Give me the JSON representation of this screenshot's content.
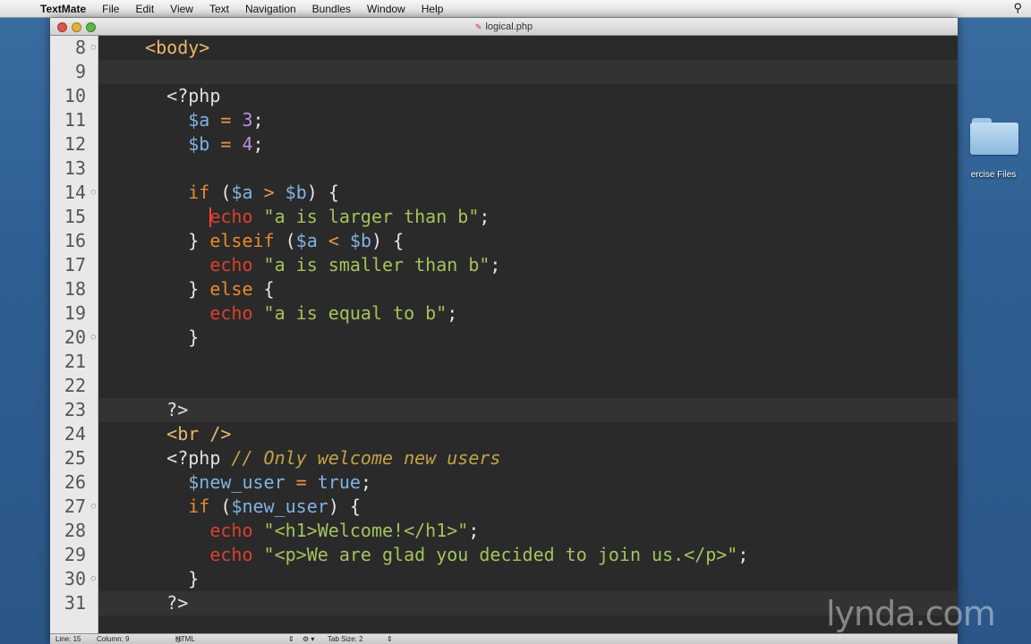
{
  "menubar": {
    "apple_glyph": "",
    "items": [
      "TextMate",
      "File",
      "Edit",
      "View",
      "Text",
      "Navigation",
      "Bundles",
      "Window",
      "Help"
    ],
    "spotlight_glyph": "⚲"
  },
  "desktop": {
    "folder_label": "ercise Files"
  },
  "window": {
    "title": "logical.php",
    "doc_icon": "✎"
  },
  "editor": {
    "lines": [
      {
        "n": "8",
        "fold": "○",
        "hl": false,
        "tokens": [
          [
            "t-plain",
            "  "
          ],
          [
            "t-tag",
            "<body>"
          ]
        ]
      },
      {
        "n": "9",
        "fold": "",
        "hl": true,
        "tokens": []
      },
      {
        "n": "10",
        "fold": "",
        "hl": false,
        "tokens": [
          [
            "t-plain",
            "    "
          ],
          [
            "t-php",
            "<?php"
          ]
        ]
      },
      {
        "n": "11",
        "fold": "",
        "hl": false,
        "tokens": [
          [
            "t-plain",
            "      "
          ],
          [
            "t-var",
            "$a"
          ],
          [
            "t-plain",
            " "
          ],
          [
            "t-op",
            "="
          ],
          [
            "t-plain",
            " "
          ],
          [
            "t-num",
            "3"
          ],
          [
            "t-plain",
            ";"
          ]
        ]
      },
      {
        "n": "12",
        "fold": "",
        "hl": false,
        "tokens": [
          [
            "t-plain",
            "      "
          ],
          [
            "t-var",
            "$b"
          ],
          [
            "t-plain",
            " "
          ],
          [
            "t-op",
            "="
          ],
          [
            "t-plain",
            " "
          ],
          [
            "t-num",
            "4"
          ],
          [
            "t-plain",
            ";"
          ]
        ]
      },
      {
        "n": "13",
        "fold": "",
        "hl": false,
        "tokens": []
      },
      {
        "n": "14",
        "fold": "○",
        "hl": false,
        "tokens": [
          [
            "t-plain",
            "      "
          ],
          [
            "t-kw",
            "if"
          ],
          [
            "t-plain",
            " ("
          ],
          [
            "t-var",
            "$a"
          ],
          [
            "t-plain",
            " "
          ],
          [
            "t-op",
            ">"
          ],
          [
            "t-plain",
            " "
          ],
          [
            "t-var",
            "$b"
          ],
          [
            "t-plain",
            ") {"
          ]
        ]
      },
      {
        "n": "15",
        "fold": "",
        "hl": false,
        "tokens": [
          [
            "t-plain",
            "        "
          ],
          [
            "t-echo",
            "echo"
          ],
          [
            "t-plain",
            " "
          ],
          [
            "t-str",
            "\"a is larger than b\""
          ],
          [
            "t-plain",
            ";"
          ]
        ]
      },
      {
        "n": "16",
        "fold": "",
        "hl": false,
        "tokens": [
          [
            "t-plain",
            "      } "
          ],
          [
            "t-kw",
            "elseif"
          ],
          [
            "t-plain",
            " ("
          ],
          [
            "t-var",
            "$a"
          ],
          [
            "t-plain",
            " "
          ],
          [
            "t-op",
            "<"
          ],
          [
            "t-plain",
            " "
          ],
          [
            "t-var",
            "$b"
          ],
          [
            "t-plain",
            ") {"
          ]
        ]
      },
      {
        "n": "17",
        "fold": "",
        "hl": false,
        "tokens": [
          [
            "t-plain",
            "        "
          ],
          [
            "t-echo",
            "echo"
          ],
          [
            "t-plain",
            " "
          ],
          [
            "t-str",
            "\"a is smaller than b\""
          ],
          [
            "t-plain",
            ";"
          ]
        ]
      },
      {
        "n": "18",
        "fold": "",
        "hl": false,
        "tokens": [
          [
            "t-plain",
            "      } "
          ],
          [
            "t-kw",
            "else"
          ],
          [
            "t-plain",
            " {"
          ]
        ]
      },
      {
        "n": "19",
        "fold": "",
        "hl": false,
        "tokens": [
          [
            "t-plain",
            "        "
          ],
          [
            "t-echo",
            "echo"
          ],
          [
            "t-plain",
            " "
          ],
          [
            "t-str",
            "\"a is equal to b\""
          ],
          [
            "t-plain",
            ";"
          ]
        ]
      },
      {
        "n": "20",
        "fold": "○",
        "hl": false,
        "tokens": [
          [
            "t-plain",
            "      }"
          ]
        ]
      },
      {
        "n": "21",
        "fold": "",
        "hl": false,
        "tokens": []
      },
      {
        "n": "22",
        "fold": "",
        "hl": false,
        "tokens": []
      },
      {
        "n": "23",
        "fold": "",
        "hl": true,
        "tokens": [
          [
            "t-plain",
            "    "
          ],
          [
            "t-php",
            "?>"
          ]
        ]
      },
      {
        "n": "24",
        "fold": "",
        "hl": false,
        "tokens": [
          [
            "t-plain",
            "    "
          ],
          [
            "t-tag",
            "<br />"
          ]
        ]
      },
      {
        "n": "25",
        "fold": "",
        "hl": false,
        "tokens": [
          [
            "t-plain",
            "    "
          ],
          [
            "t-php",
            "<?php"
          ],
          [
            "t-plain",
            " "
          ],
          [
            "t-cmt",
            "// Only welcome new users"
          ]
        ]
      },
      {
        "n": "26",
        "fold": "",
        "hl": false,
        "tokens": [
          [
            "t-plain",
            "      "
          ],
          [
            "t-var",
            "$new_user"
          ],
          [
            "t-plain",
            " "
          ],
          [
            "t-op",
            "="
          ],
          [
            "t-plain",
            " "
          ],
          [
            "t-const",
            "true"
          ],
          [
            "t-plain",
            ";"
          ]
        ]
      },
      {
        "n": "27",
        "fold": "○",
        "hl": false,
        "tokens": [
          [
            "t-plain",
            "      "
          ],
          [
            "t-kw",
            "if"
          ],
          [
            "t-plain",
            " ("
          ],
          [
            "t-var",
            "$new_user"
          ],
          [
            "t-plain",
            ") {"
          ]
        ]
      },
      {
        "n": "28",
        "fold": "",
        "hl": false,
        "tokens": [
          [
            "t-plain",
            "        "
          ],
          [
            "t-echo",
            "echo"
          ],
          [
            "t-plain",
            " "
          ],
          [
            "t-str",
            "\"<h1>Welcome!</h1>\""
          ],
          [
            "t-plain",
            ";"
          ]
        ]
      },
      {
        "n": "29",
        "fold": "",
        "hl": false,
        "tokens": [
          [
            "t-plain",
            "        "
          ],
          [
            "t-echo",
            "echo"
          ],
          [
            "t-plain",
            " "
          ],
          [
            "t-str",
            "\"<p>We are glad you decided to join us.</p>\""
          ],
          [
            "t-plain",
            ";"
          ]
        ]
      },
      {
        "n": "30",
        "fold": "○",
        "hl": false,
        "tokens": [
          [
            "t-plain",
            "      }"
          ]
        ]
      },
      {
        "n": "31",
        "fold": "",
        "hl": true,
        "tokens": [
          [
            "t-plain",
            "    "
          ],
          [
            "t-php",
            "?>"
          ]
        ]
      }
    ]
  },
  "statusbar": {
    "line": "Line: 15",
    "column": "Column: 9",
    "language": "HTML",
    "tab_size": "Tab Size:  2"
  },
  "watermark": "lynda.com",
  "colors": {
    "editor_bg": "#2a2a2a",
    "variable": "#7fb3e3",
    "keyword": "#e8892c",
    "echo": "#d8412c",
    "string": "#a5c25c",
    "comment": "#c4a347"
  }
}
